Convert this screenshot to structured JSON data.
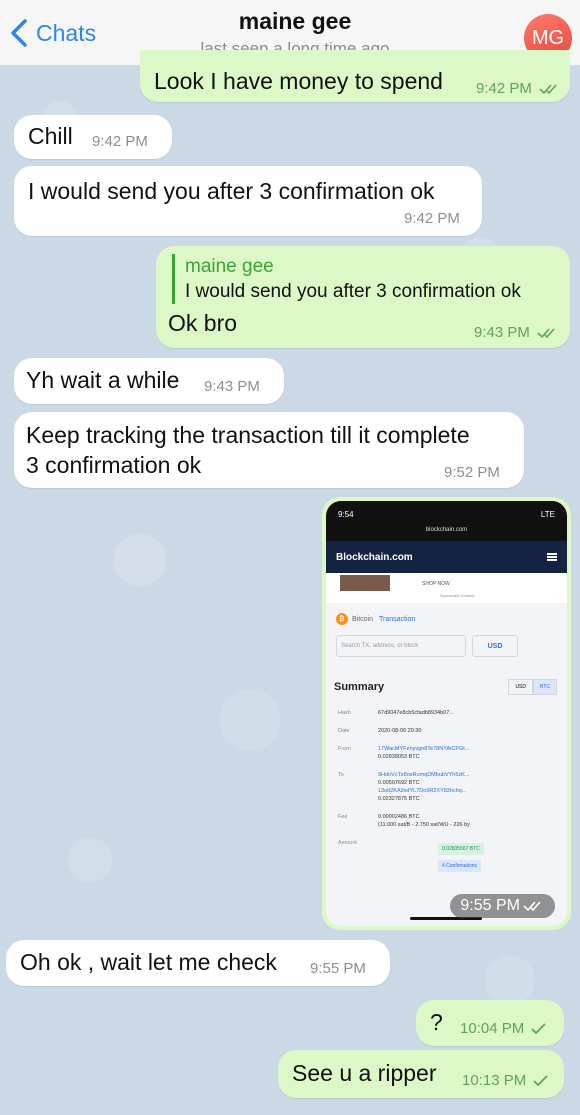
{
  "header": {
    "back_label": "Chats",
    "title": "maine gee",
    "status": "last seen a long time ago",
    "avatar_initials": "MG"
  },
  "messages": [
    {
      "dir": "out",
      "text": "Look I have money to spend",
      "time": "9:42 PM"
    },
    {
      "dir": "in",
      "text": "Chill",
      "time": "9:42 PM"
    },
    {
      "dir": "in",
      "text": "I would send you after 3 confirmation ok",
      "time": "9:42 PM"
    },
    {
      "dir": "out",
      "reply_name": "maine gee",
      "reply_text": "I would send you after 3 confirmation ok",
      "text": "Ok bro",
      "time": "9:43 PM"
    },
    {
      "dir": "in",
      "text": "Yh wait a while",
      "time": "9:43 PM"
    },
    {
      "dir": "in",
      "text_line1": "Keep tracking the transaction till it complete",
      "text_line2": "3 confirmation ok",
      "time": "9:52 PM"
    },
    {
      "dir": "out",
      "type": "photo",
      "time": "9:55 PM"
    },
    {
      "dir": "in",
      "text": "Oh ok , wait let me check",
      "time": "9:55 PM"
    },
    {
      "dir": "out",
      "text": "?",
      "time": "10:04 PM"
    },
    {
      "dir": "out",
      "text": "See u a ripper",
      "time": "10:13 PM"
    }
  ],
  "photo": {
    "status_time": "9:54",
    "status_right": "LTE",
    "url": "blockchain.com",
    "brand": "Blockchain.com",
    "ad_button": "SHOP NOW",
    "ad_sponsored": "Sponsored Content",
    "crumb_coin": "Bitcoin",
    "crumb_page": "Transaction",
    "search_placeholder": "Search TX, address, or block",
    "currency": "USD",
    "summary_title": "Summary",
    "toggle_usd": "USD",
    "toggle_btc": "BTC",
    "hash_label": "Hash",
    "hash_value": "67d9047e8cb5cfadb8934b07...",
    "date_label": "Date",
    "date_value": "2020-08-06 20:30",
    "from_label": "From",
    "from_addr": "17WacMYFenyvgn8Te78NYAiCPGt...",
    "from_amount": "0.02838053 BTC",
    "to_label": "To",
    "to_addr1": "9HdoVcTz8osRumqDMbubVYh5zK...",
    "to_amt1": "0.00507692 BTC",
    "to_addr2": "13utt2KA9xdYL7Do9R2XY83hchq...",
    "to_amt2": "0.02327875 BTC",
    "fee_label": "Fee",
    "fee_value": "0.00002486 BTC",
    "fee_detail": "(11.000 sat/B - 2.750 sat/WU - 226 by",
    "amount_label": "Amount",
    "amount_value": "0.02835567 BTC",
    "confirmations": "4 Confirmations"
  },
  "colors": {
    "accent": "#2d86e8",
    "outgoing_bubble": "#dcf8c6",
    "incoming_bubble": "#ffffff",
    "avatar": "#e8473d"
  }
}
